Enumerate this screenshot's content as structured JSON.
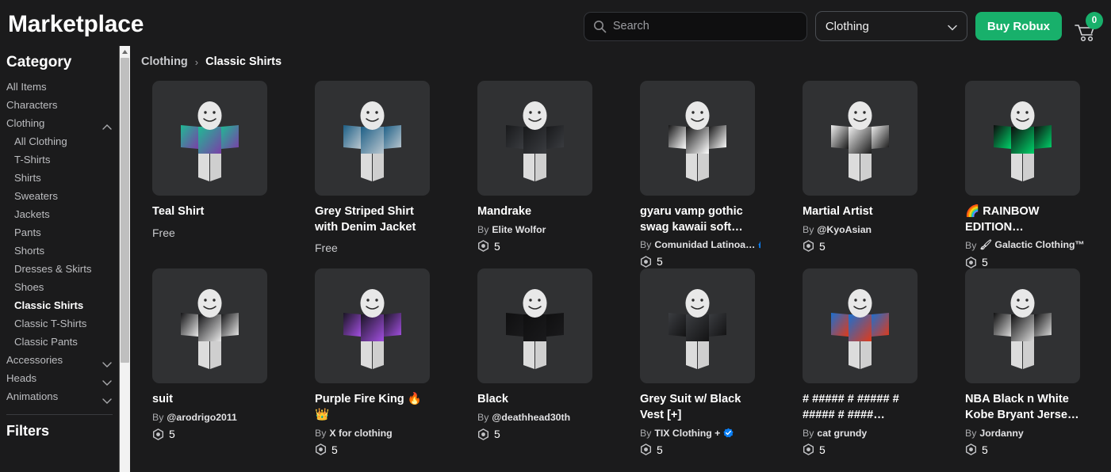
{
  "header": {
    "brand": "Marketplace",
    "search": {
      "placeholder": "Search",
      "value": "",
      "icon": "search-icon"
    },
    "category_dropdown": {
      "value": "Clothing",
      "icon": "chevron-down-icon"
    },
    "buy_robux_label": "Buy Robux",
    "cart": {
      "icon": "cart-icon",
      "badge_count": "0"
    },
    "accent_green": "#18b06b"
  },
  "sidebar": {
    "title": "Category",
    "items": [
      {
        "label": "All Items",
        "level": 0,
        "active": false,
        "caret": ""
      },
      {
        "label": "Characters",
        "level": 0,
        "active": false,
        "caret": ""
      },
      {
        "label": "Clothing",
        "level": 0,
        "active": false,
        "caret": "up"
      },
      {
        "label": "All Clothing",
        "level": 1,
        "active": false,
        "caret": ""
      },
      {
        "label": "T-Shirts",
        "level": 1,
        "active": false,
        "caret": ""
      },
      {
        "label": "Shirts",
        "level": 1,
        "active": false,
        "caret": ""
      },
      {
        "label": "Sweaters",
        "level": 1,
        "active": false,
        "caret": ""
      },
      {
        "label": "Jackets",
        "level": 1,
        "active": false,
        "caret": ""
      },
      {
        "label": "Pants",
        "level": 1,
        "active": false,
        "caret": ""
      },
      {
        "label": "Shorts",
        "level": 1,
        "active": false,
        "caret": ""
      },
      {
        "label": "Dresses & Skirts",
        "level": 1,
        "active": false,
        "caret": ""
      },
      {
        "label": "Shoes",
        "level": 1,
        "active": false,
        "caret": ""
      },
      {
        "label": "Classic Shirts",
        "level": 1,
        "active": true,
        "caret": ""
      },
      {
        "label": "Classic T-Shirts",
        "level": 1,
        "active": false,
        "caret": ""
      },
      {
        "label": "Classic Pants",
        "level": 1,
        "active": false,
        "caret": ""
      },
      {
        "label": "Accessories",
        "level": 0,
        "active": false,
        "caret": "down"
      },
      {
        "label": "Heads",
        "level": 0,
        "active": false,
        "caret": "down"
      },
      {
        "label": "Animations",
        "level": 0,
        "active": false,
        "caret": "down"
      }
    ],
    "filters_title": "Filters"
  },
  "breadcrumb": {
    "parent": "Clothing",
    "separator": "›",
    "current": "Classic Shirts"
  },
  "items": [
    {
      "title": "Teal Shirt",
      "by": "",
      "price": "",
      "free_label": "Free",
      "verified": false,
      "shirt": "#1fba94",
      "shirt2": "#7a3fa8",
      "torso": "#e3e3e3"
    },
    {
      "title": "Grey Striped Shirt with Denim Jacket",
      "by": "",
      "price": "",
      "free_label": "Free",
      "verified": false,
      "shirt": "#1d5f86",
      "shirt2": "#b9c6cf",
      "torso": "#dfe3e6"
    },
    {
      "title": "Mandrake",
      "by": "Elite Wolfor",
      "price": "5",
      "free_label": "",
      "verified": false,
      "shirt": "#18191b",
      "shirt2": "#3a3c40",
      "torso": "#1c1d1f"
    },
    {
      "title": "gyaru vamp gothic swag kawaii soft…",
      "by": "Comunidad Latinoa…",
      "price": "5",
      "free_label": "",
      "verified": true,
      "shirt": "#161617",
      "shirt2": "#ffffff",
      "torso": "#222225"
    },
    {
      "title": "Martial Artist",
      "by": "@KyoAsian",
      "price": "5",
      "free_label": "",
      "verified": false,
      "shirt": "#efefef",
      "shirt2": "#1a1a1a",
      "torso": "#f0f0f0"
    },
    {
      "title": "🌈 RAINBOW EDITION…",
      "by": "🖌 Galactic Clothing™ …",
      "price": "5",
      "free_label": "",
      "verified": false,
      "shirt": "#0d0d0d",
      "shirt2": "#00d26a",
      "torso": "#111111"
    },
    {
      "title": "suit",
      "by": "@arodrigo2011",
      "price": "5",
      "free_label": "",
      "verified": false,
      "shirt": "#151517",
      "shirt2": "#e8e8e8",
      "torso": "#19191b"
    },
    {
      "title": "Purple Fire King 🔥👑",
      "by": "X for clothing",
      "price": "5",
      "free_label": "",
      "verified": false,
      "shirt": "#1a1524",
      "shirt2": "#a24fe0",
      "torso": "#1d1730"
    },
    {
      "title": "Black",
      "by": "@deathhead30th",
      "price": "5",
      "free_label": "",
      "verified": false,
      "shirt": "#0f0f10",
      "shirt2": "#1a1a1c",
      "torso": "#0e0e0f"
    },
    {
      "title": "Grey Suit w/ Black Vest [+]",
      "by": "TIX Clothing +",
      "price": "5",
      "free_label": "",
      "verified": true,
      "shirt": "#3b3d41",
      "shirt2": "#131314",
      "torso": "#34363a"
    },
    {
      "title": "# ##### # ##### # ##### # ####…",
      "by": "cat grundy",
      "price": "5",
      "free_label": "",
      "verified": false,
      "shirt": "#1b6fd0",
      "shirt2": "#e03a1a",
      "torso": "#d8d83a"
    },
    {
      "title": "NBA Black n White Kobe Bryant Jerse…",
      "by": "Jordanny",
      "price": "5",
      "free_label": "",
      "verified": false,
      "shirt": "#101011",
      "shirt2": "#d8d8d8",
      "torso": "#151516"
    }
  ],
  "labels": {
    "by_prefix": "By",
    "robux_icon": "robux-icon",
    "verified_icon": "verified-badge-icon"
  }
}
